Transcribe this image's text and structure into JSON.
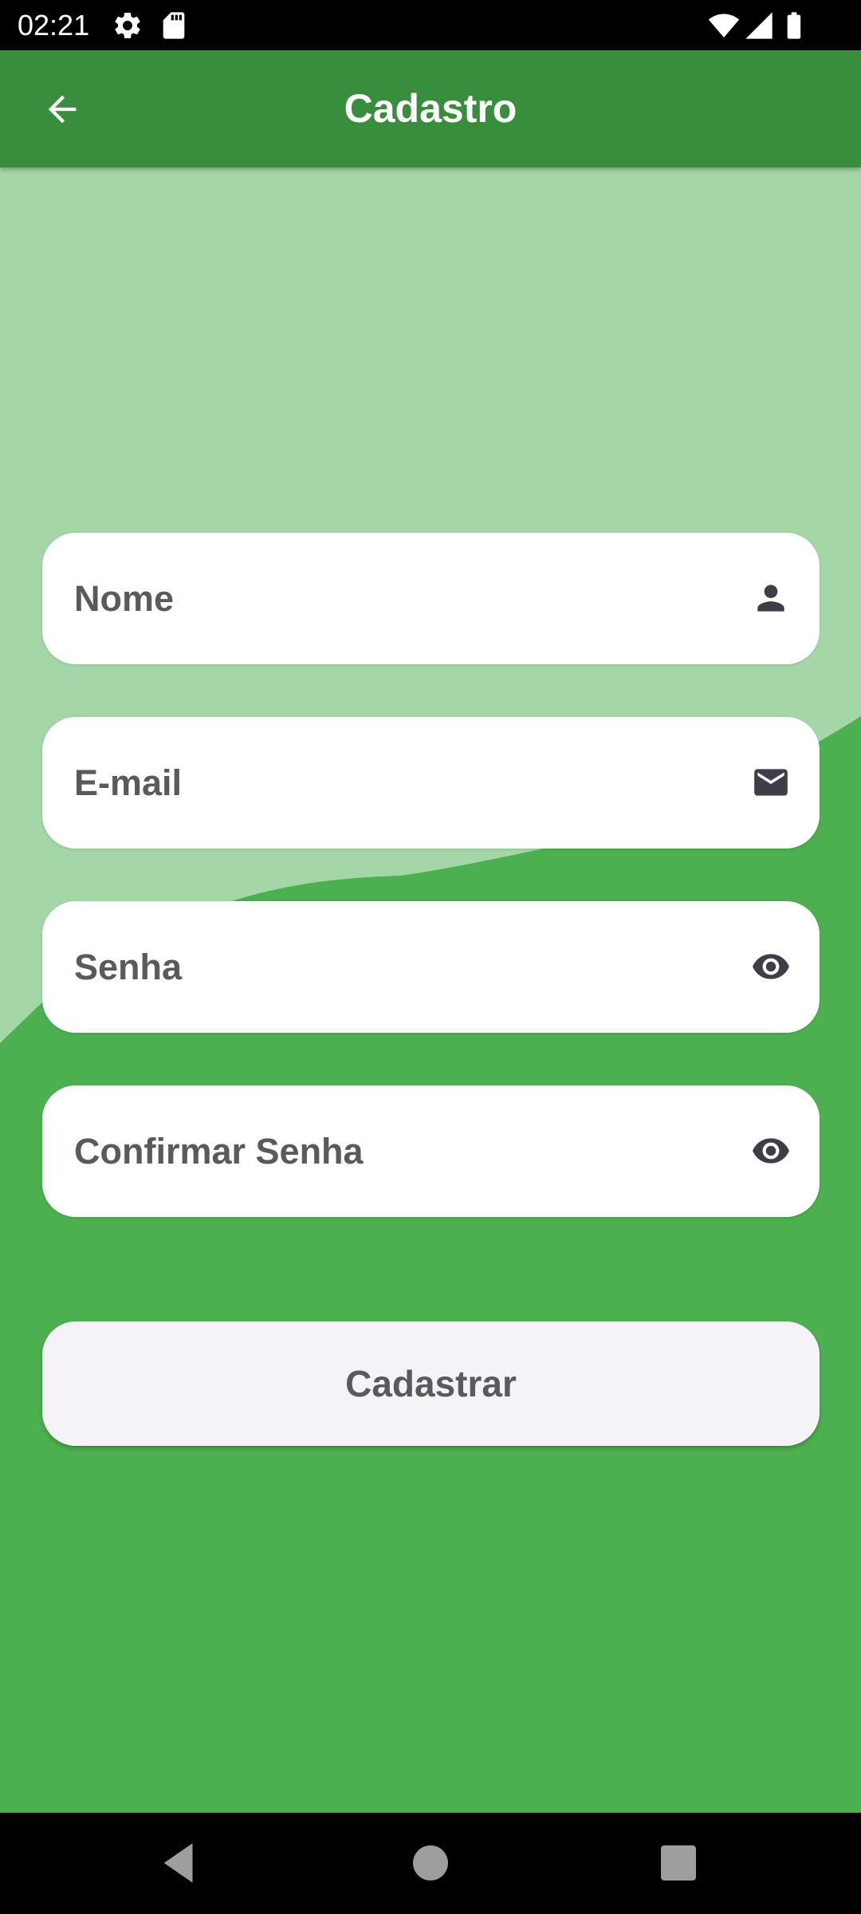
{
  "status_bar": {
    "time": "02:21",
    "icons": [
      "settings-icon",
      "sd-card-icon",
      "wifi-icon",
      "signal-icon",
      "battery-icon"
    ]
  },
  "app_bar": {
    "title": "Cadastro",
    "back_icon": "arrow-back-icon"
  },
  "form": {
    "fields": [
      {
        "label": "Nome",
        "value": "",
        "icon": "person-icon"
      },
      {
        "label": "E-mail",
        "value": "",
        "icon": "mail-icon"
      },
      {
        "label": "Senha",
        "value": "",
        "icon": "eye-icon"
      },
      {
        "label": "Confirmar Senha",
        "value": "",
        "icon": "eye-icon"
      }
    ],
    "submit_label": "Cadastrar"
  },
  "nav_bar": {
    "buttons": [
      "back-triangle-icon",
      "home-circle-icon",
      "recents-square-icon"
    ]
  },
  "colors": {
    "app_bar": "#388e3c",
    "background_dark": "#4caf50",
    "background_light": "#a5d6a7",
    "field_background": "#ffffff",
    "button_background": "#f5f3f8",
    "text": "#5a5a5a",
    "icon": "#3f3d47"
  }
}
